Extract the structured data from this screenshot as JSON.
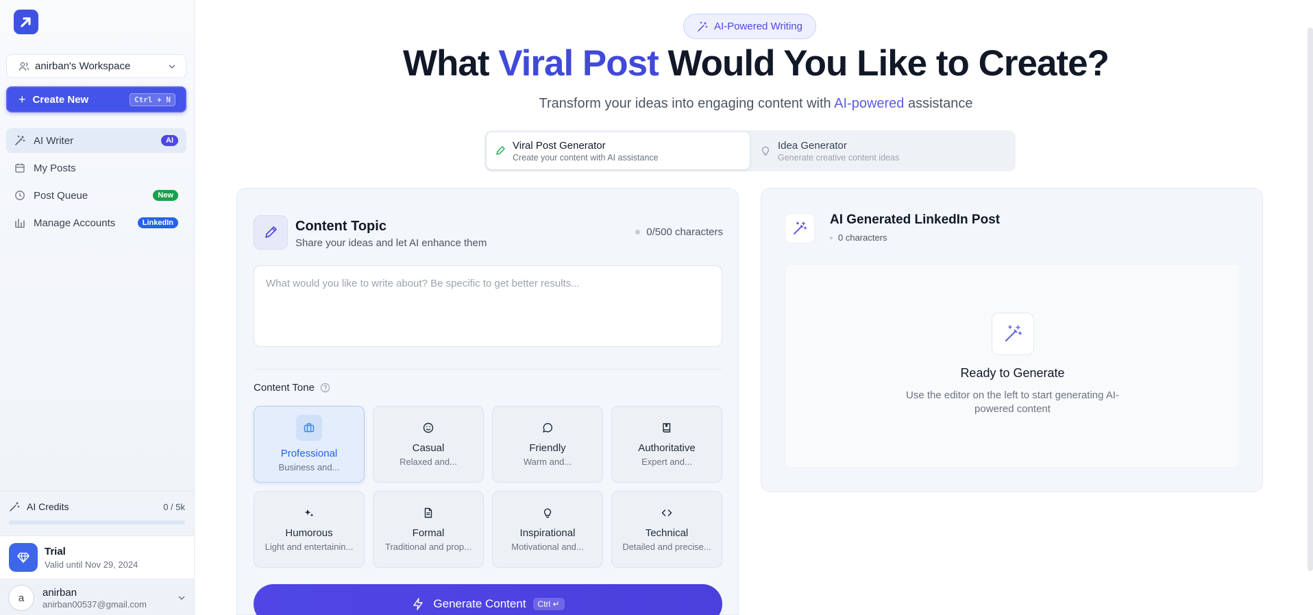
{
  "sidebar": {
    "workspace": "anirban's Workspace",
    "create_label": "Create New",
    "create_shortcut": "Ctrl + N",
    "items": [
      {
        "label": "AI Writer",
        "badge": "AI",
        "badge_color": "#4f46e5",
        "icon": "magic-wand-icon"
      },
      {
        "label": "My Posts",
        "icon": "calendar-icon"
      },
      {
        "label": "Post Queue",
        "badge": "New",
        "badge_color": "#16a34a",
        "icon": "clock-icon"
      },
      {
        "label": "Manage Accounts",
        "badge": "LinkedIn",
        "badge_color": "#2563eb",
        "icon": "accounts-icon"
      }
    ],
    "credits": {
      "label": "AI Credits",
      "value": "0 / 5k",
      "used_fraction": 0
    },
    "plan": {
      "name": "Trial",
      "valid": "Valid until Nov 29, 2024"
    },
    "user": {
      "initial": "a",
      "name": "anirban",
      "email": "anirban00537@gmail.com"
    }
  },
  "header": {
    "chip": "AI-Powered Writing",
    "title_pre": "What ",
    "title_highlight": "Viral Post",
    "title_post": " Would You Like to Create?",
    "subtitle_pre": "Transform your ideas into engaging content with ",
    "subtitle_highlight": "AI-powered",
    "subtitle_post": " assistance"
  },
  "tabs": [
    {
      "title": "Viral Post Generator",
      "desc": "Create your content with AI assistance"
    },
    {
      "title": "Idea Generator",
      "desc": "Generate creative content ideas"
    }
  ],
  "editor": {
    "title": "Content Topic",
    "subtitle": "Share your ideas and let AI enhance them",
    "char_count": "0/500 characters",
    "placeholder": "What would you like to write about? Be specific to get better results...",
    "tone_label": "Content Tone",
    "tones": [
      {
        "name": "Professional",
        "desc": "Business and...",
        "icon": "briefcase-icon"
      },
      {
        "name": "Casual",
        "desc": "Relaxed and...",
        "icon": "smile-icon"
      },
      {
        "name": "Friendly",
        "desc": "Warm and...",
        "icon": "chat-bubble-icon"
      },
      {
        "name": "Authoritative",
        "desc": "Expert and...",
        "icon": "book-icon"
      },
      {
        "name": "Humorous",
        "desc": "Light and entertainin...",
        "icon": "sparkles-icon"
      },
      {
        "name": "Formal",
        "desc": "Traditional and prop...",
        "icon": "document-icon"
      },
      {
        "name": "Inspirational",
        "desc": "Motivational and...",
        "icon": "lightbulb-icon"
      },
      {
        "name": "Technical",
        "desc": "Detailed and precise...",
        "icon": "code-icon"
      }
    ],
    "generate_label": "Generate Content",
    "generate_shortcut": "Ctrl ↵"
  },
  "output": {
    "title": "AI Generated LinkedIn Post",
    "chars": "0 characters",
    "ready_title": "Ready to Generate",
    "ready_desc": "Use the editor on the left to start generating AI-powered content"
  }
}
